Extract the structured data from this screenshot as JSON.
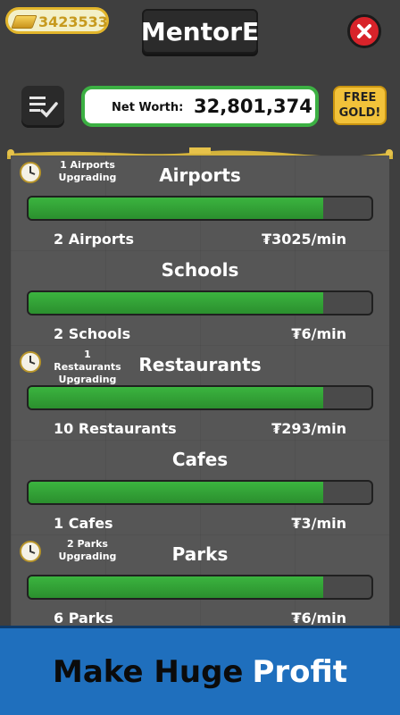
{
  "header": {
    "gold_amount": "3423533",
    "title": "MentorE",
    "net_worth_label": "Net Worth:",
    "net_worth_value": "32,801,374",
    "free_gold_line1": "FREE",
    "free_gold_line2": "GOLD!"
  },
  "businesses": [
    {
      "name": "Airports",
      "status_line1": "1 Airports",
      "status_line2": "Upgrading",
      "count": "2 Airports",
      "rate": "₮3025/min",
      "progress": 0.86,
      "upgrading": true
    },
    {
      "name": "Schools",
      "status_line1": "",
      "status_line2": "",
      "count": "2 Schools",
      "rate": "₮6/min",
      "progress": 0.86,
      "upgrading": false
    },
    {
      "name": "Restaurants",
      "status_line1": "1 Restaurants",
      "status_line2": "Upgrading",
      "count": "10 Restaurants",
      "rate": "₮293/min",
      "progress": 0.86,
      "upgrading": true
    },
    {
      "name": "Cafes",
      "status_line1": "",
      "status_line2": "",
      "count": "1 Cafes",
      "rate": "₮3/min",
      "progress": 0.86,
      "upgrading": false
    },
    {
      "name": "Parks",
      "status_line1": "2 Parks",
      "status_line2": "Upgrading",
      "count": "6 Parks",
      "rate": "₮6/min",
      "progress": 0.86,
      "upgrading": true
    }
  ],
  "banner": {
    "part1": "Make Huge",
    "part2": "Profit"
  },
  "colors": {
    "progress_fill": "#3bb43f",
    "net_worth_border": "#3cb043",
    "banner_bg": "#1f6fbd",
    "close_bg": "#d8232a",
    "gold_text": "#c79a1e"
  },
  "icons": {
    "gold": "gold-bar-icon",
    "close": "close-icon",
    "tasks": "checklist-icon",
    "upgrade": "clock-icon"
  }
}
